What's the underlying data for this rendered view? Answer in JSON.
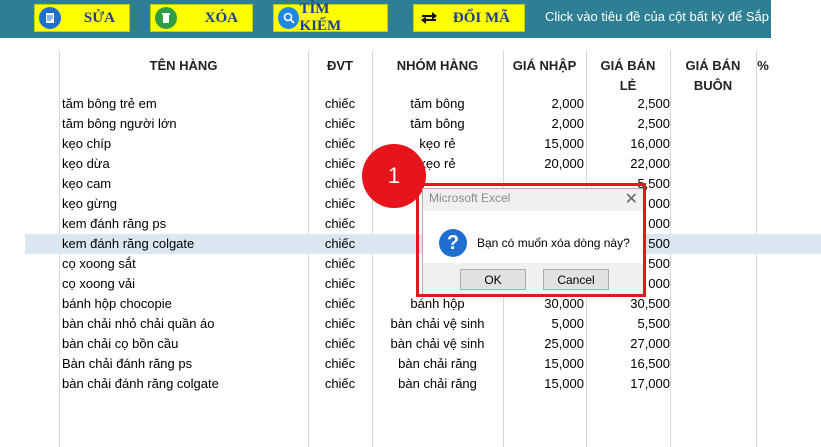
{
  "toolbar": {
    "buttons": [
      {
        "label": "SỬA",
        "icon": "edit-icon"
      },
      {
        "label": "XÓA",
        "icon": "trash-icon"
      },
      {
        "label": "TÌM KIẾM",
        "icon": "search-icon"
      },
      {
        "label": "ĐỔI MÃ",
        "icon": "swap-icon"
      }
    ],
    "hint": "Click vào tiêu đề của cột bất kỳ để Sắp"
  },
  "columns": {
    "name": "TÊN HÀNG",
    "dvt": "ĐVT",
    "group": "NHÓM HÀNG",
    "price_in": "GIÁ NHẬP",
    "price_retail_1": "GIÁ BÁN",
    "price_retail_2": "LẺ",
    "price_wholesale_1": "GIÁ BÁN",
    "price_wholesale_2": "BUÔN",
    "percent": "%"
  },
  "rows": [
    {
      "name": "tăm bông trẻ em",
      "dvt": "chiếc",
      "group": "tăm bông",
      "price_in": "2,000",
      "price_out": "2,500"
    },
    {
      "name": "tăm bông người lớn",
      "dvt": "chiếc",
      "group": "tăm bông",
      "price_in": "2,000",
      "price_out": "2,500"
    },
    {
      "name": "kẹo chíp",
      "dvt": "chiếc",
      "group": "kẹo rẻ",
      "price_in": "15,000",
      "price_out": "16,000"
    },
    {
      "name": "kẹo dừa",
      "dvt": "chiếc",
      "group": "kẹo rẻ",
      "price_in": "20,000",
      "price_out": "22,000"
    },
    {
      "name": "kẹo cam",
      "dvt": "chiếc",
      "group": "",
      "price_in": "",
      "price_out": "5,500"
    },
    {
      "name": "kẹo gừng",
      "dvt": "chiếc",
      "group": "",
      "price_in": "",
      "price_out": "000"
    },
    {
      "name": "kem đánh răng ps",
      "dvt": "chiếc",
      "group": "kem",
      "price_in": "",
      "price_out": "000"
    },
    {
      "name": "kem đánh răng colgate",
      "dvt": "chiếc",
      "group": "kem",
      "price_in": "",
      "price_out": "500"
    },
    {
      "name": "cọ xoong sắt",
      "dvt": "chiếc",
      "group": "c",
      "price_in": "",
      "price_out": "500"
    },
    {
      "name": "cọ xoong vải",
      "dvt": "chiếc",
      "group": "c",
      "price_in": "",
      "price_out": "000"
    },
    {
      "name": "bánh hộp chocopie",
      "dvt": "chiếc",
      "group": "bánh hộp",
      "price_in": "30,000",
      "price_out": "30,500"
    },
    {
      "name": "bàn chải nhỏ chải quần áo",
      "dvt": "chiếc",
      "group": "bàn chải vệ sinh",
      "price_in": "5,000",
      "price_out": "5,500"
    },
    {
      "name": "bàn chải cọ bồn cầu",
      "dvt": "chiếc",
      "group": "bàn chải vệ sinh",
      "price_in": "25,000",
      "price_out": "27,000"
    },
    {
      "name": "Bàn chải đánh răng ps",
      "dvt": "chiếc",
      "group": "bàn chải răng",
      "price_in": "15,000",
      "price_out": "16,500"
    },
    {
      "name": "bàn chải đánh răng colgate",
      "dvt": "chiếc",
      "group": "bàn chải răng",
      "price_in": "15,000",
      "price_out": "17,000"
    }
  ],
  "marker": "1",
  "dialog": {
    "title": "Microsoft Excel",
    "message": "Bạn có muốn xóa dòng này?",
    "ok": "OK",
    "cancel": "Cancel",
    "close": "✕"
  },
  "colors": {
    "toolbar_bg": "#2e7f93",
    "button_bg": "#ffff00",
    "selected_row": "#dce6f1",
    "highlight_red": "#e8141c"
  }
}
